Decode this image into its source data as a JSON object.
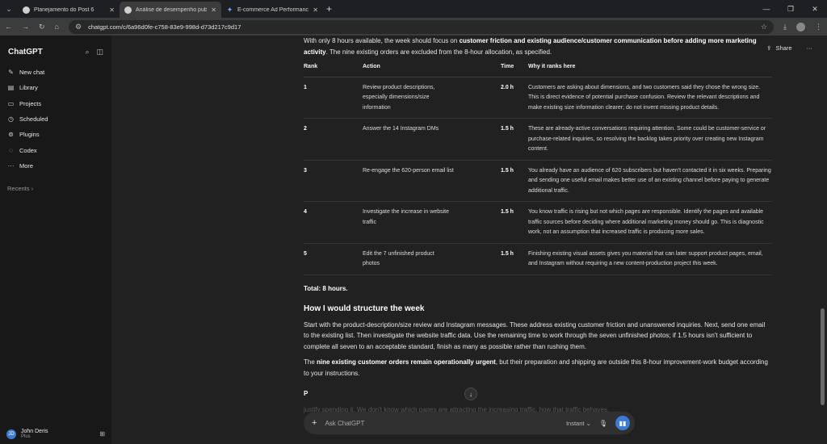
{
  "browser": {
    "tabs": [
      {
        "label": "Planejamento do Post 6",
        "active": false
      },
      {
        "label": "Análise de desempenho publici",
        "active": true
      },
      {
        "label": "E-commerce Ad Performance A",
        "active": false
      }
    ],
    "url": "chatgpt.com/c/6a96d0fe-c758-83e9-998d-d73d217c9d17"
  },
  "sidebar": {
    "title": "ChatGPT",
    "items": [
      {
        "label": "New chat",
        "icon": "edit-icon"
      },
      {
        "label": "Library",
        "icon": "library-icon"
      },
      {
        "label": "Projects",
        "icon": "folder-icon"
      },
      {
        "label": "Scheduled",
        "icon": "clock-icon"
      },
      {
        "label": "Plugins",
        "icon": "plugin-icon"
      },
      {
        "label": "Codex",
        "icon": "codex-icon"
      },
      {
        "label": "More",
        "icon": "more-icon"
      }
    ],
    "recents": "Recents ›",
    "user": {
      "name": "John Deris",
      "plan": "Plus",
      "initials": "JD"
    }
  },
  "topbar": {
    "share": "Share"
  },
  "content": {
    "intro_pre": "With only 8 hours available, the week should focus on ",
    "intro_bold": "customer friction and existing audience/customer communication before adding more marketing activity",
    "intro_post": ". The nine existing orders are excluded from the 8-hour allocation, as specified.",
    "table": {
      "headers": [
        "Rank",
        "Action",
        "Time",
        "Why it ranks here"
      ],
      "rows": [
        {
          "rank": "1",
          "action": "Review product descriptions, especially dimensions/size information",
          "time": "2.0 h",
          "why": "Customers are asking about dimensions, and two customers said they chose the wrong size. This is direct evidence of potential purchase confusion. Review the relevant descriptions and make existing size information clearer; do not invent missing product details."
        },
        {
          "rank": "2",
          "action": "Answer the 14 Instagram DMs",
          "time": "1.5 h",
          "why": "These are already-active conversations requiring attention. Some could be customer-service or purchase-related inquiries, so resolving the backlog takes priority over creating new Instagram content."
        },
        {
          "rank": "3",
          "action": "Re-engage the 620-person email list",
          "time": "1.5 h",
          "why": "You already have an audience of 620 subscribers but haven't contacted it in six weeks. Preparing and sending one useful email makes better use of an existing channel before paying to generate additional traffic."
        },
        {
          "rank": "4",
          "action": "Investigate the increase in website traffic",
          "time": "1.5 h",
          "why": "You know traffic is rising but not which pages are responsible. Identify the pages and available traffic sources before deciding where additional marketing money should go. This is diagnostic work, not an assumption that increased traffic is producing more sales."
        },
        {
          "rank": "5",
          "action": "Edit the 7 unfinished product photos",
          "time": "1.5 h",
          "why": "Finishing existing visual assets gives you material that can later support product pages, email, and Instagram without requiring a new content-production project this week."
        }
      ]
    },
    "total": "Total: 8 hours.",
    "section_title": "How I would structure the week",
    "structure_para": "Start with the product-description/size review and Instagram messages. These address existing customer friction and unanswered inquiries. Next, send one email to the existing list. Then investigate the website traffic data. Use the remaining time to work through the seven unfinished photos; if 1.5 hours isn't sufficient to complete all seven to an acceptable standard, finish as many as possible rather than rushing them.",
    "orders_pre": "The ",
    "orders_bold": "nine existing customer orders remain operationally urgent",
    "orders_post": ", but their preparation and shipping are outside this 8-hour improvement-work budget according to your instructions.",
    "trailing_heading": "P",
    "trailing_text": "justify spending it. We don't know which pages are attracting the increasing traffic, how that traffic behaves,"
  },
  "composer": {
    "placeholder": "Ask ChatGPT",
    "mode": "Instant ⌄"
  }
}
